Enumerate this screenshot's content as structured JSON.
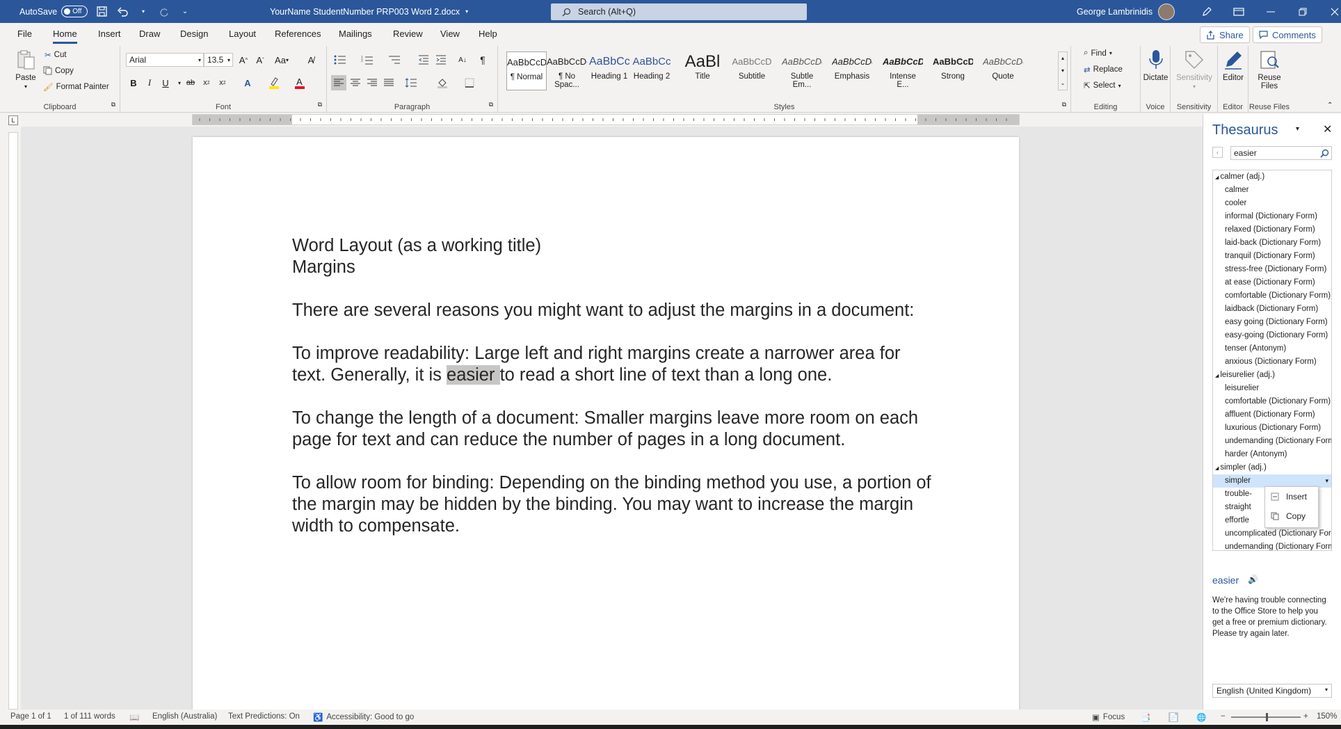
{
  "titlebar": {
    "autosave_label": "AutoSave",
    "autosave_state": "Off",
    "doc_title": "YourName StudentNumber PRP003 Word 2.docx",
    "search_placeholder": "Search (Alt+Q)",
    "user_name": "George Lambrinidis"
  },
  "tabs": [
    "File",
    "Home",
    "Insert",
    "Draw",
    "Design",
    "Layout",
    "References",
    "Mailings",
    "Review",
    "View",
    "Help"
  ],
  "share_label": "Share",
  "comments_label": "Comments",
  "clipboard": {
    "paste": "Paste",
    "cut": "Cut",
    "copy": "Copy",
    "format_painter": "Format Painter",
    "label": "Clipboard"
  },
  "font": {
    "name": "Arial",
    "size": "13.5",
    "label": "Font",
    "case_btn": "Aa"
  },
  "paragraph": {
    "label": "Paragraph"
  },
  "styles": {
    "label": "Styles",
    "items": [
      {
        "preview": "AaBbCcDc",
        "name": "¶ Normal"
      },
      {
        "preview": "AaBbCcDc",
        "name": "¶ No Spac..."
      },
      {
        "preview": "AaBbCc",
        "name": "Heading 1"
      },
      {
        "preview": "AaBbCc",
        "name": "Heading 2"
      },
      {
        "preview": "AaBl",
        "name": "Title"
      },
      {
        "preview": "AaBbCcD",
        "name": "Subtitle"
      },
      {
        "preview": "AaBbCcDc",
        "name": "Subtle Em..."
      },
      {
        "preview": "AaBbCcDc",
        "name": "Emphasis"
      },
      {
        "preview": "AaBbCcDc",
        "name": "Intense E..."
      },
      {
        "preview": "AaBbCcDc",
        "name": "Strong"
      },
      {
        "preview": "AaBbCcDc",
        "name": "Quote"
      }
    ]
  },
  "editing": {
    "find": "Find",
    "replace": "Replace",
    "select": "Select",
    "label": "Editing"
  },
  "voice": {
    "dictate": "Dictate",
    "label": "Voice"
  },
  "sensitivity": {
    "btn": "Sensitivity",
    "label": "Sensitivity"
  },
  "editor": {
    "btn": "Editor",
    "label": "Editor"
  },
  "reuse": {
    "btn1": "Reuse",
    "btn2": "Files",
    "label": "Reuse Files"
  },
  "document": {
    "line1": "Word Layout (as a working title)",
    "line2": "Margins",
    "para1": "There are several reasons you might want to adjust the margins in a document:",
    "para2_a": "To improve readability: Large left and right margins create a narrower area for text. Generally, it is ",
    "para2_hl": "easier ",
    "para2_b": "to read a short line of text than a long one.",
    "para3": "To change the length of a document: Smaller margins leave more room on each page for text and can reduce the number of pages in a long document.",
    "para4": "To allow room for binding: Depending on the binding method you use, a portion of the margin may be hidden by the binding. You may want to increase the margin width to compensate."
  },
  "thesaurus": {
    "title": "Thesaurus",
    "search_value": "easier",
    "items": [
      {
        "text": "calmer (adj.)",
        "kind": "head"
      },
      {
        "text": "calmer",
        "kind": "entry"
      },
      {
        "text": "cooler",
        "kind": "entry"
      },
      {
        "text": "informal (Dictionary Form)",
        "kind": "entry"
      },
      {
        "text": "relaxed (Dictionary Form)",
        "kind": "entry"
      },
      {
        "text": "laid-back (Dictionary Form)",
        "kind": "entry"
      },
      {
        "text": "tranquil (Dictionary Form)",
        "kind": "entry"
      },
      {
        "text": "stress-free (Dictionary Form)",
        "kind": "entry"
      },
      {
        "text": "at ease (Dictionary Form)",
        "kind": "entry"
      },
      {
        "text": "comfortable (Dictionary Form)",
        "kind": "entry"
      },
      {
        "text": "laidback (Dictionary Form)",
        "kind": "entry"
      },
      {
        "text": "easy going (Dictionary Form)",
        "kind": "entry"
      },
      {
        "text": "easy-going (Dictionary Form)",
        "kind": "entry"
      },
      {
        "text": "tenser (Antonym)",
        "kind": "entry"
      },
      {
        "text": "anxious (Dictionary Form)",
        "kind": "entry"
      },
      {
        "text": "leisurelier (adj.)",
        "kind": "head"
      },
      {
        "text": "leisurelier",
        "kind": "entry"
      },
      {
        "text": "comfortable (Dictionary Form)",
        "kind": "entry"
      },
      {
        "text": "affluent (Dictionary Form)",
        "kind": "entry"
      },
      {
        "text": "luxurious (Dictionary Form)",
        "kind": "entry"
      },
      {
        "text": "undemanding (Dictionary Form)",
        "kind": "entry"
      },
      {
        "text": "harder (Antonym)",
        "kind": "entry"
      },
      {
        "text": "simpler (adj.)",
        "kind": "head"
      },
      {
        "text": "simpler",
        "kind": "sel"
      },
      {
        "text": "trouble-",
        "kind": "entry"
      },
      {
        "text": "straight",
        "kind": "entry"
      },
      {
        "text": "effortle",
        "kind": "entry"
      },
      {
        "text": "uncomplicated (Dictionary Form)",
        "kind": "entry"
      },
      {
        "text": "undemanding (Dictionary Form)",
        "kind": "entry"
      }
    ],
    "context_menu": [
      "Insert",
      "Copy"
    ],
    "word": "easier",
    "message": "We're having trouble connecting to the Office Store to help you get a free or premium dictionary. Please try again later.",
    "language": "English (United Kingdom)"
  },
  "status": {
    "page": "Page 1 of 1",
    "words": "1 of 111 words",
    "language": "English (Australia)",
    "predictions": "Text Predictions: On",
    "accessibility": "Accessibility: Good to go",
    "focus": "Focus",
    "zoom": "150%"
  },
  "colors": {
    "accent": "#2b579a",
    "highlight": "#c8c6c4",
    "selection": "#cfe4fa"
  }
}
